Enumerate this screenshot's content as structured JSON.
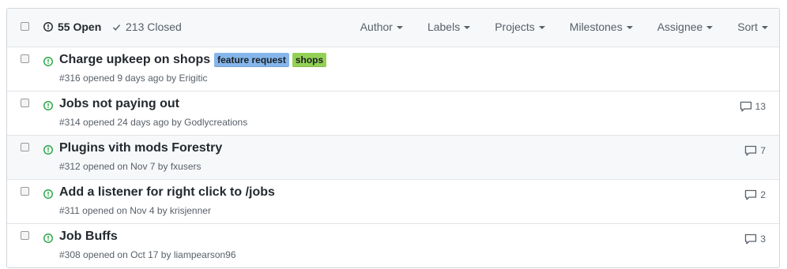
{
  "header": {
    "open_label": "55 Open",
    "closed_label": "213 Closed",
    "filters": [
      "Author",
      "Labels",
      "Projects",
      "Milestones",
      "Assignee",
      "Sort"
    ]
  },
  "colors": {
    "open_icon": "#28a745",
    "label_feature_request": "#84b6eb",
    "label_shops": "#93d154"
  },
  "issues": [
    {
      "title": "Charge upkeep on shops",
      "number": "#316",
      "opened_text": "opened 9 days ago by",
      "author": "Erigitic",
      "labels": [
        "feature request",
        "shops"
      ],
      "comments": ""
    },
    {
      "title": "Jobs not paying out",
      "number": "#314",
      "opened_text": "opened 24 days ago by",
      "author": "Godlycreations",
      "labels": [],
      "comments": "13"
    },
    {
      "title": "Plugins vith mods Forestry",
      "number": "#312",
      "opened_text": "opened on Nov 7 by",
      "author": "fxusers",
      "labels": [],
      "comments": "7"
    },
    {
      "title": "Add a listener for right click to /jobs",
      "number": "#311",
      "opened_text": "opened on Nov 4 by",
      "author": "krisjenner",
      "labels": [],
      "comments": "2"
    },
    {
      "title": "Job Buffs",
      "number": "#308",
      "opened_text": "opened on Oct 17 by",
      "author": "liampearson96",
      "labels": [],
      "comments": "3"
    }
  ]
}
